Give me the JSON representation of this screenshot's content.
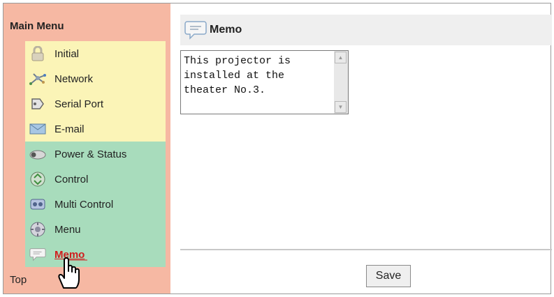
{
  "sidebar": {
    "title": "Main Menu",
    "items": [
      {
        "label": "Initial",
        "icon": "lock-icon"
      },
      {
        "label": "Network",
        "icon": "network-icon"
      },
      {
        "label": "Serial Port",
        "icon": "serial-port-icon"
      },
      {
        "label": "E-mail",
        "icon": "email-icon"
      },
      {
        "label": "Power & Status",
        "icon": "projector-icon"
      },
      {
        "label": "Control",
        "icon": "control-icon"
      },
      {
        "label": "Multi Control",
        "icon": "multi-control-icon"
      },
      {
        "label": "Menu",
        "icon": "menu-icon"
      },
      {
        "label": "Memo",
        "icon": "memo-icon",
        "active": true
      }
    ],
    "top_link": "Top"
  },
  "header": {
    "title": "Memo",
    "icon": "memo-icon"
  },
  "memo": {
    "text": "This projector is installed at the theater No.3."
  },
  "actions": {
    "save_label": "Save"
  },
  "colors": {
    "sidebar_bg": "#f6b8a3",
    "group1_bg": "#fbf4b7",
    "group2_bg": "#a8dcbc",
    "active_text": "#d01e1e"
  }
}
